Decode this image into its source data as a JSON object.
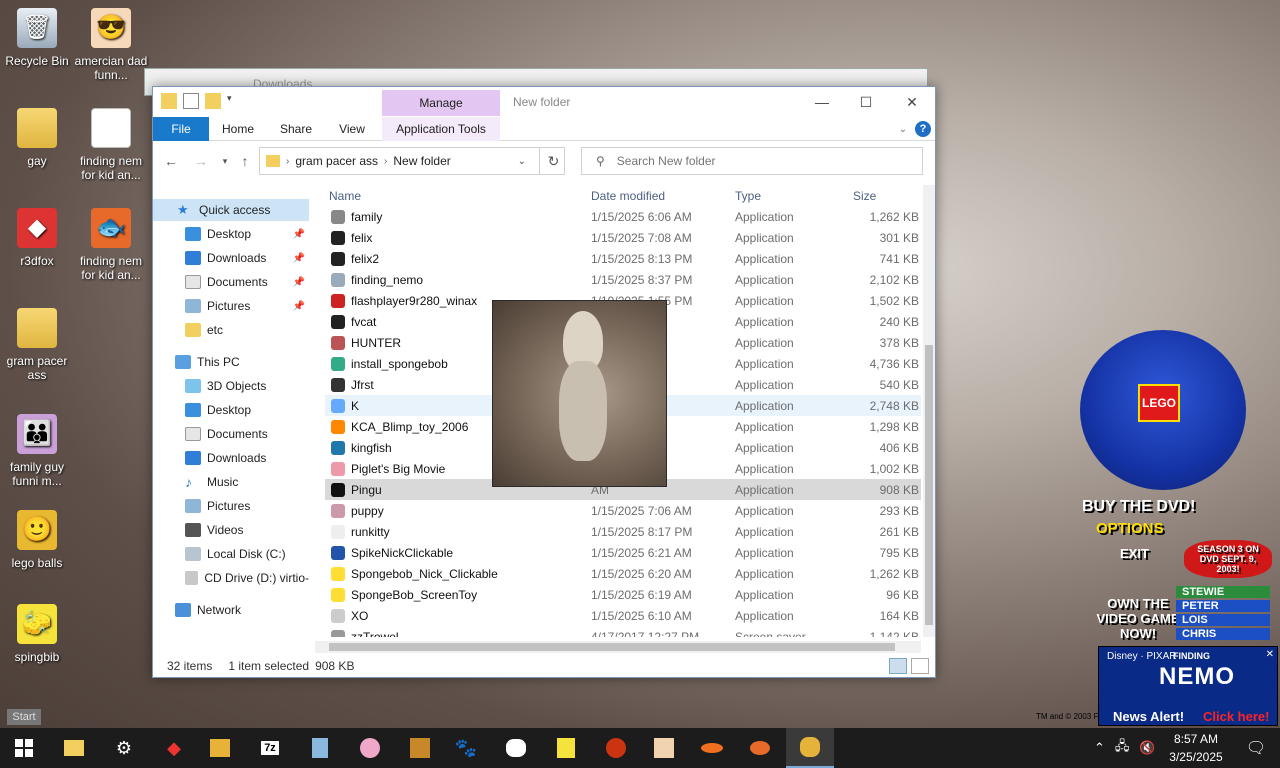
{
  "desktop": {
    "icons": [
      {
        "label": "Recycle Bin"
      },
      {
        "label": "amercian dad funn..."
      },
      {
        "label": "gay"
      },
      {
        "label": "finding nem for kid an..."
      },
      {
        "label": "r3dfox"
      },
      {
        "label": "finding nem for kid an..."
      },
      {
        "label": "gram pacer ass"
      },
      {
        "label": "family guy funni m..."
      },
      {
        "label": "lego balls"
      },
      {
        "label": "spingbib"
      }
    ],
    "start_label": "Start"
  },
  "back_window": {
    "title": "Downloads"
  },
  "explorer": {
    "title": "New folder",
    "manage_tab": "Manage",
    "ribbon_tabs": [
      "File",
      "Home",
      "Share",
      "View",
      "Application Tools"
    ],
    "address": {
      "segments": [
        "gram pacer ass",
        "New folder"
      ]
    },
    "search": {
      "placeholder": "Search New folder"
    },
    "nav_pane": [
      {
        "label": "Quick access"
      },
      {
        "label": "Desktop"
      },
      {
        "label": "Downloads"
      },
      {
        "label": "Documents"
      },
      {
        "label": "Pictures"
      },
      {
        "label": "etc"
      },
      {
        "label": "This PC"
      },
      {
        "label": "3D Objects"
      },
      {
        "label": "Desktop"
      },
      {
        "label": "Documents"
      },
      {
        "label": "Downloads"
      },
      {
        "label": "Music"
      },
      {
        "label": "Pictures"
      },
      {
        "label": "Videos"
      },
      {
        "label": "Local Disk (C:)"
      },
      {
        "label": "CD Drive (D:) virtio-"
      },
      {
        "label": "Network"
      }
    ],
    "columns": [
      "Name",
      "Date modified",
      "Type",
      "Size"
    ],
    "files": [
      {
        "name": "family",
        "date": "1/15/2025 6:06 AM",
        "type": "Application",
        "size": "1,262 KB"
      },
      {
        "name": "felix",
        "date": "1/15/2025 7:08 AM",
        "type": "Application",
        "size": "301 KB"
      },
      {
        "name": "felix2",
        "date": "1/15/2025 8:13 PM",
        "type": "Application",
        "size": "741 KB"
      },
      {
        "name": "finding_nemo",
        "date": "1/15/2025 8:37 PM",
        "type": "Application",
        "size": "2,102 KB"
      },
      {
        "name": "flashplayer9r280_winax",
        "date": "1/19/2025 1:55 PM",
        "type": "Application",
        "size": "1,502 KB"
      },
      {
        "name": "fvcat",
        "date": "AM",
        "type": "Application",
        "size": "240 KB"
      },
      {
        "name": "HUNTER",
        "date": "AM",
        "type": "Application",
        "size": "378 KB"
      },
      {
        "name": "install_spongebob",
        "date": "PM",
        "type": "Application",
        "size": "4,736 KB"
      },
      {
        "name": "Jfrst",
        "date": "PM",
        "type": "Application",
        "size": "540 KB"
      },
      {
        "name": "K",
        "date": "52 AM",
        "type": "Application",
        "size": "2,748 KB"
      },
      {
        "name": "KCA_Blimp_toy_2006",
        "date": "AM",
        "type": "Application",
        "size": "1,298 KB"
      },
      {
        "name": "kingfish",
        "date": "AM",
        "type": "Application",
        "size": "406 KB"
      },
      {
        "name": "Piglet's Big Movie",
        "date": "AM",
        "type": "Application",
        "size": "1,002 KB"
      },
      {
        "name": "Pingu",
        "date": "AM",
        "type": "Application",
        "size": "908 KB"
      },
      {
        "name": "puppy",
        "date": "1/15/2025 7:06 AM",
        "type": "Application",
        "size": "293 KB"
      },
      {
        "name": "runkitty",
        "date": "1/15/2025 8:17 PM",
        "type": "Application",
        "size": "261 KB"
      },
      {
        "name": "SpikeNickClickable",
        "date": "1/15/2025 6:21 AM",
        "type": "Application",
        "size": "795 KB"
      },
      {
        "name": "Spongebob_Nick_Clickable",
        "date": "1/15/2025 6:20 AM",
        "type": "Application",
        "size": "1,262 KB"
      },
      {
        "name": "SpongeBob_ScreenToy",
        "date": "1/15/2025 6:19 AM",
        "type": "Application",
        "size": "96 KB"
      },
      {
        "name": "XO",
        "date": "1/15/2025 6:10 AM",
        "type": "Application",
        "size": "164 KB"
      },
      {
        "name": "zzTrowel",
        "date": "4/17/2017 12:27 PM",
        "type": "Screen saver",
        "size": "1,142 KB"
      }
    ],
    "status": {
      "count": "32 items",
      "selection": "1 item selected",
      "size": "908 KB"
    }
  },
  "ad": {
    "lego": "LEGO",
    "buy_dvd": "BUY THE DVD!",
    "options": "OPTIONS",
    "exit": "EXIT",
    "season": "SEASON 3 ON DVD SEPT. 9, 2003!",
    "own_game": "OWN THE VIDEO GAME NOW!",
    "names": [
      "STEWIE",
      "PETER",
      "LOIS",
      "CHRIS"
    ],
    "copyright": "TM and © 2003 Fox and",
    "nemo": {
      "brand": "Disney · PIXAR",
      "finding": "FINDING",
      "title": "NEMO",
      "alert": "News Alert!",
      "click": "Click here!"
    }
  },
  "taskbar": {
    "clock_time": "8:57 AM",
    "clock_date": "3/25/2025"
  }
}
